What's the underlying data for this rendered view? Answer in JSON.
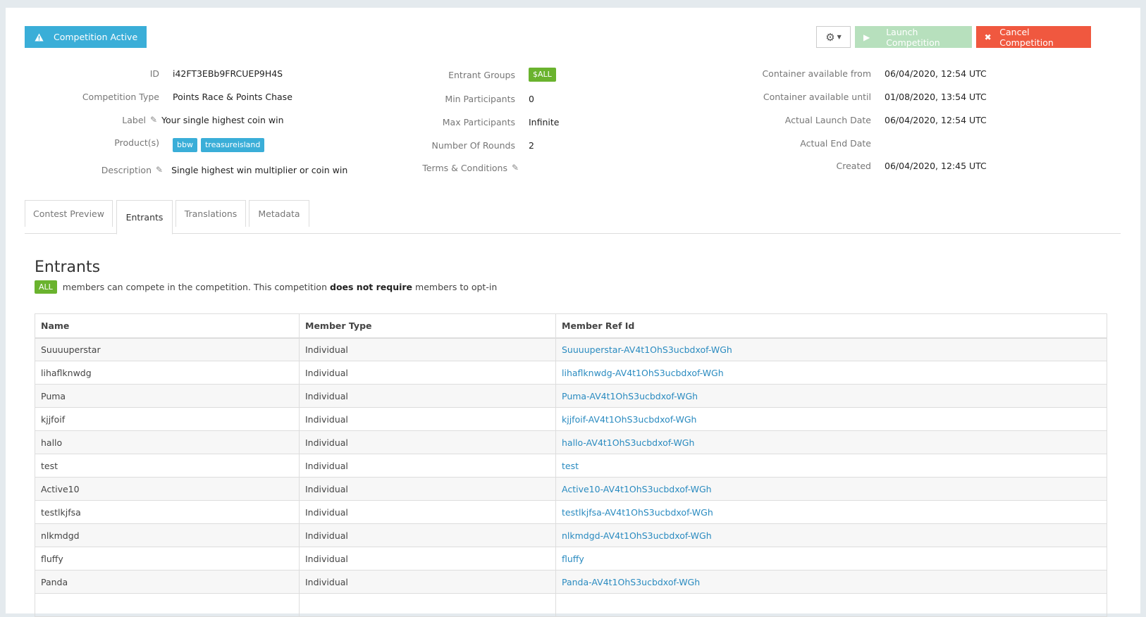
{
  "header": {
    "status_label": "Competition Active",
    "status_icon": "warning-icon",
    "gear_icon": "gear-icon",
    "launch_label": "Launch Competition",
    "launch_icon": "play-icon",
    "cancel_label": "Cancel Competition",
    "cancel_icon": "close-icon"
  },
  "details": {
    "left": [
      {
        "label": "ID",
        "value": "i42FT3EBb9FRCUEP9H4S"
      },
      {
        "label": "Competition Type",
        "value": "Points Race & Points Chase"
      },
      {
        "label": "Label",
        "value": "Your single highest coin win"
      },
      {
        "label": "Product(s)",
        "products": [
          "bbw",
          "treasureisland"
        ]
      },
      {
        "label": "Description",
        "value": "Single highest win multiplier or coin win"
      }
    ],
    "middle": [
      {
        "label": "Entrant Groups",
        "badge": "$ALL"
      },
      {
        "label": "Min Participants",
        "value": "0"
      },
      {
        "label": "Max Participants",
        "value": "Infinite"
      },
      {
        "label": "Number Of Rounds",
        "value": "2"
      },
      {
        "label": "Terms & Conditions",
        "value": ""
      }
    ],
    "right": [
      {
        "label": "Container available from",
        "value": "06/04/2020, 12:54 UTC"
      },
      {
        "label": "Container available until",
        "value": "01/08/2020, 13:54 UTC"
      },
      {
        "label": "Actual Launch Date",
        "value": "06/04/2020, 12:54 UTC"
      },
      {
        "label": "Actual End Date",
        "value": ""
      },
      {
        "label": "Created",
        "value": "06/04/2020, 12:45 UTC"
      }
    ]
  },
  "tabs": [
    {
      "label": "Contest Preview",
      "active": false
    },
    {
      "label": "Entrants",
      "active": true
    },
    {
      "label": "Translations",
      "active": false
    },
    {
      "label": "Metadata",
      "active": false
    }
  ],
  "entrants": {
    "title": "Entrants",
    "badge": "ALL",
    "desc_1": "members can compete in the competition. This competition",
    "desc_bold": "does not require",
    "desc_2": "members to opt-in",
    "columns": [
      "Name",
      "Member Type",
      "Member Ref Id"
    ],
    "rows": [
      [
        "Suuuuperstar",
        "Individual",
        "Suuuuperstar-AV4t1OhS3ucbdxof-WGh"
      ],
      [
        "lihaflknwdg",
        "Individual",
        "lihaflknwdg-AV4t1OhS3ucbdxof-WGh"
      ],
      [
        "Puma",
        "Individual",
        "Puma-AV4t1OhS3ucbdxof-WGh"
      ],
      [
        "kjjfoif",
        "Individual",
        "kjjfoif-AV4t1OhS3ucbdxof-WGh"
      ],
      [
        "hallo",
        "Individual",
        "hallo-AV4t1OhS3ucbdxof-WGh"
      ],
      [
        "test",
        "Individual",
        "test"
      ],
      [
        "Active10",
        "Individual",
        "Active10-AV4t1OhS3ucbdxof-WGh"
      ],
      [
        "testlkjfsa",
        "Individual",
        "testlkjfsa-AV4t1OhS3ucbdxof-WGh"
      ],
      [
        "nlkmdgd",
        "Individual",
        "nlkmdgd-AV4t1OhS3ucbdxof-WGh"
      ],
      [
        "fluffy",
        "Individual",
        "fluffy"
      ],
      [
        "Panda",
        "Individual",
        "Panda-AV4t1OhS3ucbdxof-WGh"
      ],
      [
        "",
        "",
        ""
      ]
    ]
  }
}
